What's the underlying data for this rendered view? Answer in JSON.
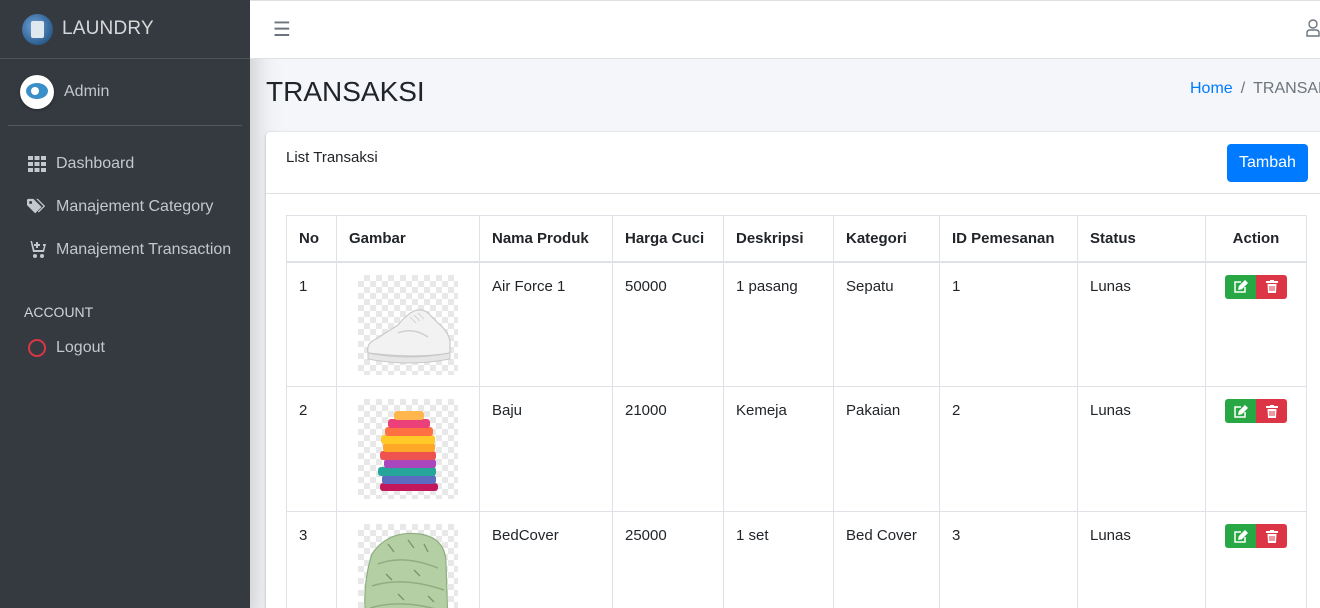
{
  "brand": {
    "name": "LAUNDRY"
  },
  "user": {
    "name": "Admin"
  },
  "sidebar": {
    "items": [
      {
        "label": "Dashboard",
        "icon": "grid-icon"
      },
      {
        "label": "Manajement Category",
        "icon": "tags-icon"
      },
      {
        "label": "Manajement Transaction",
        "icon": "cart-plus-icon"
      }
    ],
    "account_header": "ACCOUNT",
    "logout_label": "Logout"
  },
  "page": {
    "title": "TRANSAKSI",
    "breadcrumb": {
      "home": "Home",
      "current": "TRANSAKSI"
    }
  },
  "card": {
    "title": "List Transaksi",
    "add_label": "Tambah"
  },
  "table": {
    "headers": [
      "No",
      "Gambar",
      "Nama Produk",
      "Harga Cuci",
      "Deskripsi",
      "Kategori",
      "ID Pemesanan",
      "Status",
      "Action"
    ],
    "rows": [
      {
        "no": "1",
        "image": "sneaker-image",
        "nama": "Air Force 1",
        "harga": "50000",
        "deskripsi": "1 pasang",
        "kategori": "Sepatu",
        "id": "1",
        "status": "Lunas"
      },
      {
        "no": "2",
        "image": "clothes-stack-image",
        "nama": "Baju",
        "harga": "21000",
        "deskripsi": "Kemeja",
        "kategori": "Pakaian",
        "id": "2",
        "status": "Lunas"
      },
      {
        "no": "3",
        "image": "bedcover-image",
        "nama": "BedCover",
        "harga": "25000",
        "deskripsi": "1 set",
        "kategori": "Bed Cover",
        "id": "3",
        "status": "Lunas"
      }
    ]
  },
  "colors": {
    "sidebar": "#343a40",
    "primary": "#007bff",
    "success": "#28a745",
    "danger": "#dc3545",
    "logout_icon": "#dc3545"
  }
}
